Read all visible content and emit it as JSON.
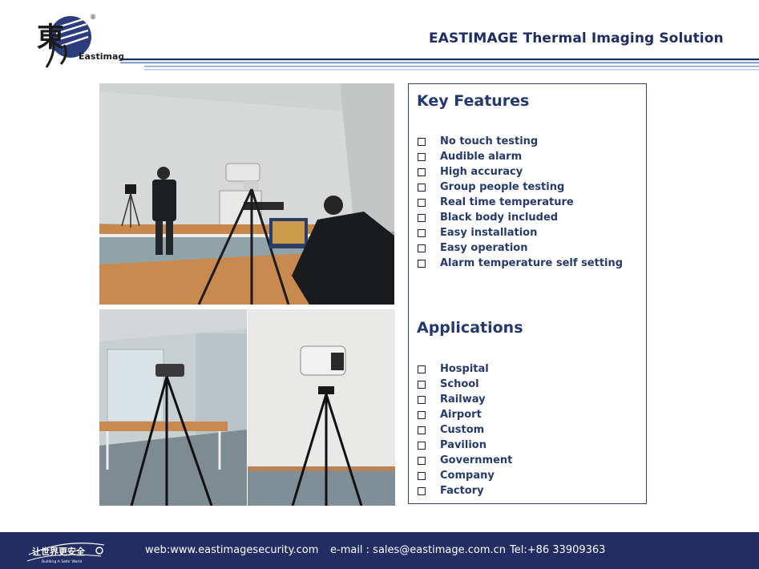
{
  "header": {
    "title": "EASTIMAGE Thermal Imaging Solution",
    "logo_text": "Eastimage",
    "logo_glyph": "東",
    "registered_mark": "®"
  },
  "features": {
    "heading": "Key Features",
    "items": [
      "No touch testing",
      "Audible alarm",
      "High accuracy",
      "Group people testing",
      "Real time temperature",
      "Black body included",
      "Easy installation",
      "Easy operation",
      "Alarm temperature self setting"
    ]
  },
  "applications": {
    "heading": "Applications",
    "items": [
      "Hospital",
      "School",
      "Railway",
      "Airport",
      "Custom",
      "Pavilion",
      "Government",
      "Company",
      "Factory"
    ]
  },
  "footer": {
    "logo_text": "让世界更安全",
    "logo_subtext": "Building A Safer World",
    "web": "web:www.eastimagesecurity.com",
    "email": "e-mail : sales@eastimage.com.cn",
    "tel": "Tel:+86 33909363"
  },
  "colors": {
    "navy": "#222e63",
    "heading": "#23386e",
    "stripe_light": "#8aa6d6"
  }
}
